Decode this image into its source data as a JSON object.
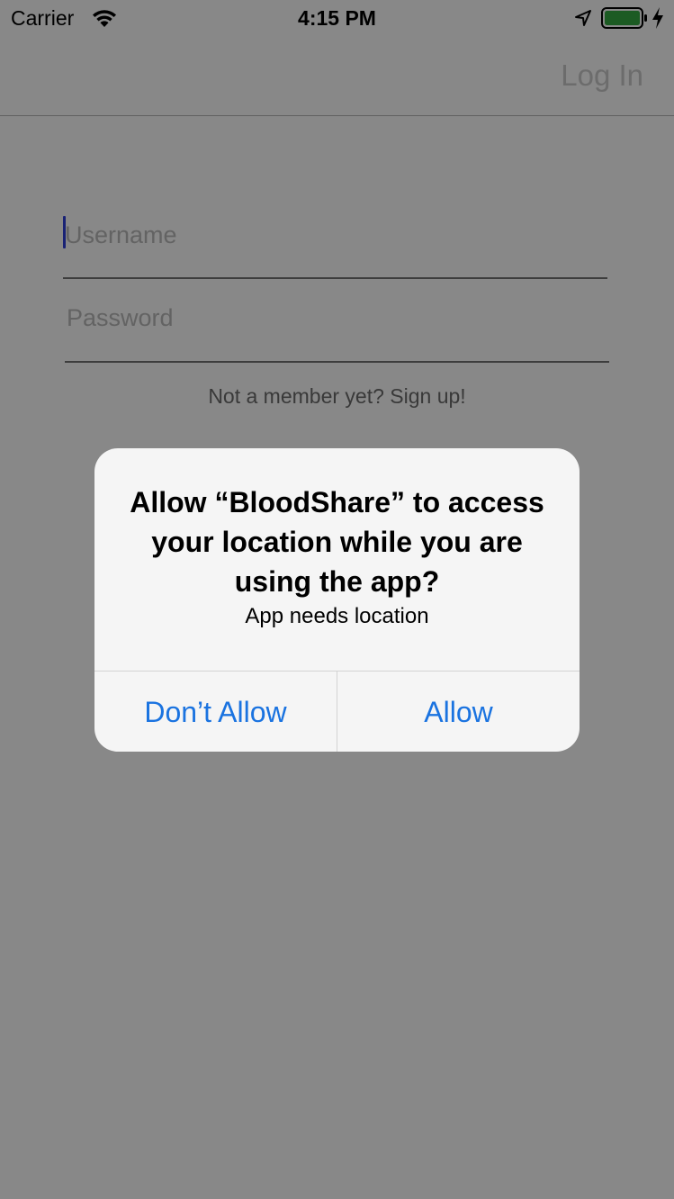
{
  "status_bar": {
    "carrier": "Carrier",
    "time": "4:15 PM",
    "icons": [
      "wifi-icon",
      "location-arrow-icon",
      "battery-icon",
      "charging-icon"
    ],
    "battery_color": "#35a942"
  },
  "nav_bar": {
    "login_label": "Log In"
  },
  "form": {
    "username_placeholder": "Username",
    "password_placeholder": "Password",
    "username_value": "",
    "password_value": "",
    "signup_text": "Not a member yet? Sign up!"
  },
  "alert": {
    "title": "Allow “BloodShare” to access your location while you are using the app?",
    "message": "App needs location",
    "deny_label": "Don’t Allow",
    "allow_label": "Allow",
    "button_color": "#1a73e0"
  }
}
